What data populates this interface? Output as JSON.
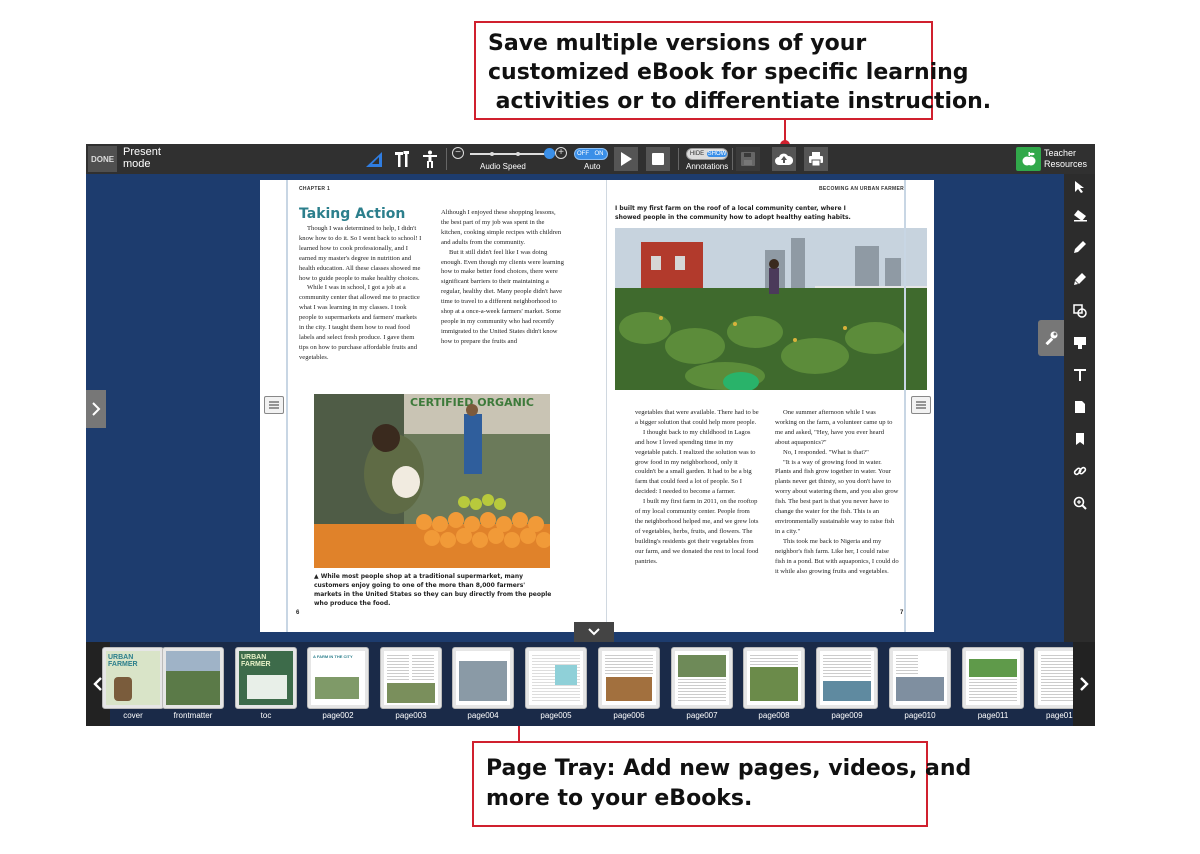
{
  "callouts": {
    "top": {
      "lines": [
        "Save multiple versions of your",
        "customized eBook for specific learning",
        " activities or to differentiate instruction."
      ]
    },
    "bottom": {
      "lines": [
        "Page Tray: Add new pages, videos, and",
        "more to your eBooks."
      ]
    }
  },
  "toolbar": {
    "done_label": "DONE",
    "present_mode": "Present mode",
    "audio_speed_label": "Audio Speed",
    "auto_label": "Auto",
    "auto_toggle": {
      "off": "OFF",
      "on": "ON"
    },
    "annotations_label": "Annotations",
    "annotations_toggle": {
      "hide": "HIDE",
      "show": "SHOW"
    },
    "teacher_resources": "Teacher Resources",
    "icons": [
      "ruler-triangle-icon",
      "tools-icon",
      "accessibility-icon",
      "minus-circle-icon",
      "plus-circle-icon",
      "play-icon",
      "stop-icon",
      "save-disk-icon",
      "cloud-upload-icon",
      "print-icon",
      "apple-icon"
    ]
  },
  "right_tools": [
    "pointer-icon",
    "eraser-icon",
    "pen-icon",
    "highlighter-icon",
    "shapes-icon",
    "sticky-note-icon",
    "text-icon",
    "page-icon",
    "bookmark-icon",
    "link-icon",
    "zoom-icon"
  ],
  "book": {
    "left": {
      "chapter": "CHAPTER 1",
      "title": "Taking Action",
      "col1": [
        "Though I was determined to help, I didn't know how to do it. So I went back to school! I learned how to cook professionally, and I earned my master's degree in nutrition and health education. All these classes showed me how to guide people to make healthy choices.",
        "While I was in school, I got a job at a community center that allowed me to practice what I was learning in my classes. I took people to supermarkets and farmers' markets in the city. I taught them how to read food labels and select fresh produce. I gave them tips on how to purchase affordable fruits and vegetables."
      ],
      "col2": [
        "Although I enjoyed these shopping lessons, the best part of my job was spent in the kitchen, cooking simple recipes with children and adults from the community.",
        "But it still didn't feel like I was doing enough. Even though my clients were learning how to make better food choices, there were significant barriers to their maintaining a regular, healthy diet. Many people didn't have time to travel to a different neighborhood to shop at a once-a-week farmers' market. Some people in my community who had recently immigrated to the United States didn't know how to prepare the fruits and"
      ],
      "photo_sign": "CERTIFIED ORGANIC",
      "caption": "▲ While most people shop at a traditional supermarket, many customers enjoy going to one of the more than 8,000 farmers' markets in the United States so they can buy directly from the people who produce the food.",
      "page_number": "6"
    },
    "right": {
      "running_head": "BECOMING AN URBAN FARMER",
      "photo_caption": "I built my first farm on the roof of a local community center, where I showed people in the community how to adopt healthy eating habits.",
      "col1": [
        "vegetables that were available. There had to be a bigger solution that could help more people.",
        "I thought back to my childhood in Lagos and how I loved spending time in my vegetable patch. I realized the solution was to grow food in my neighborhood, only it couldn't be a small garden. It had to be a big farm that could feed a lot of people. So I decided: I needed to become a farmer.",
        "I built my first farm in 2011, on the rooftop of my local community center. People from the neighborhood helped me, and we grew lots of vegetables, herbs, fruits, and flowers. The building's residents got their vegetables from our farm, and we donated the rest to local food pantries."
      ],
      "col2": [
        "One summer afternoon while I was working on the farm, a volunteer came up to me and asked, \"Hey, have you ever heard about aquaponics?\"",
        "No, I responded. \"What is that?\"",
        "\"It is a way of growing food in water. Plants and fish grow together in water. Your plants never get thirsty, so you don't have to worry about watering them, and you also grow fish. The best part is that you never have to change the water for the fish. This is an environmentally sustainable way to raise fish in a city.\"",
        "This took me back to Nigeria and my neighbor's fish farm. Like her, I could raise fish in a pond. But with aquaponics, I could do it while also growing fruits and vegetables."
      ],
      "page_number": "7"
    }
  },
  "tray": {
    "thumbnails": [
      {
        "label": "cover",
        "text": "URBAN FARMER"
      },
      {
        "label": "frontmatter",
        "text": ""
      },
      {
        "label": "toc",
        "text": "URBAN FARMER"
      },
      {
        "label": "page002",
        "text": "A FARM IN THE CITY"
      },
      {
        "label": "page003",
        "text": ""
      },
      {
        "label": "page004",
        "text": ""
      },
      {
        "label": "page005",
        "text": ""
      },
      {
        "label": "page006",
        "text": ""
      },
      {
        "label": "page007",
        "text": ""
      },
      {
        "label": "page008",
        "text": ""
      },
      {
        "label": "page009",
        "text": ""
      },
      {
        "label": "page010",
        "text": ""
      },
      {
        "label": "page011",
        "text": ""
      },
      {
        "label": "page01",
        "text": ""
      }
    ]
  },
  "colors": {
    "accent_red": "#d0202e",
    "toolbar": "#303030",
    "stage_blue": "#1d3c6e",
    "title_teal": "#2c7f8c",
    "toggle_blue": "#3a8fe8",
    "teacher_green": "#31a84a"
  }
}
